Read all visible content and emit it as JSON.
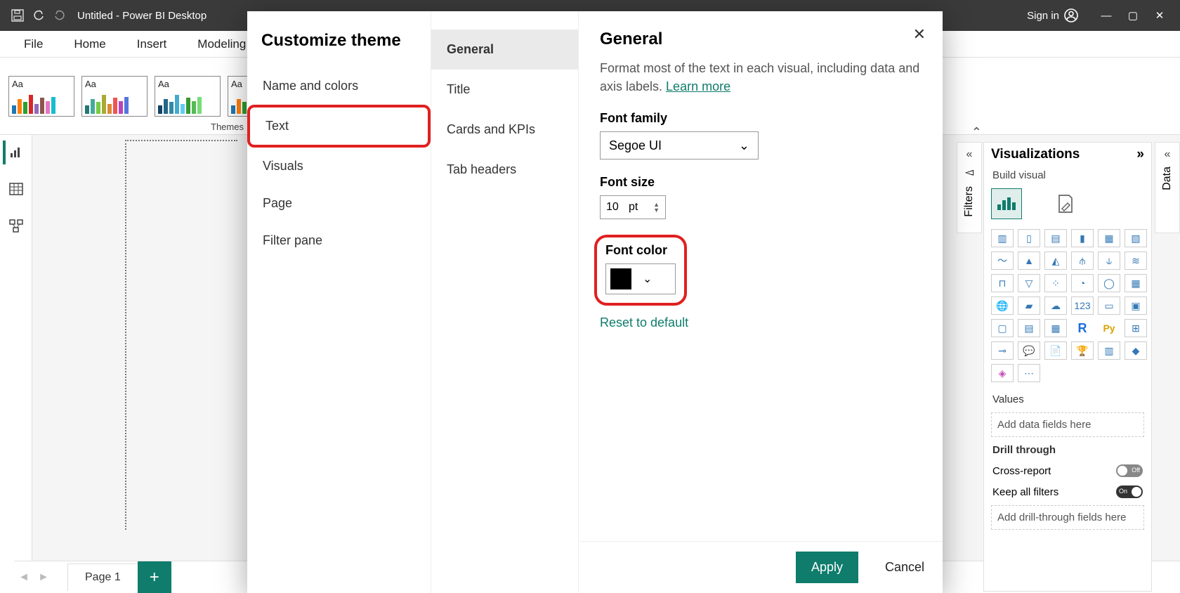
{
  "titlebar": {
    "title": "Untitled - Power BI Desktop",
    "signin": "Sign in"
  },
  "ribbon": {
    "tabs": [
      "File",
      "Home",
      "Insert",
      "Modeling"
    ],
    "group_label": "Themes",
    "aa": "Aa"
  },
  "leftbar": {
    "items": [
      "Report",
      "Data",
      "Model"
    ]
  },
  "pagetabs": {
    "page1": "Page 1"
  },
  "filters_label": "Filters",
  "data_label": "Data",
  "viz": {
    "title": "Visualizations",
    "subtitle": "Build visual",
    "values_label": "Values",
    "values_placeholder": "Add data fields here",
    "drill_label": "Drill through",
    "cross_label": "Cross-report",
    "cross_state": "Off",
    "keep_label": "Keep all filters",
    "keep_state": "On",
    "drill_placeholder": "Add drill-through fields here"
  },
  "dialog": {
    "title": "Customize theme",
    "left_items": [
      "Name and colors",
      "Text",
      "Visuals",
      "Page",
      "Filter pane"
    ],
    "mid_items": [
      "General",
      "Title",
      "Cards and KPIs",
      "Tab headers"
    ],
    "right": {
      "heading": "General",
      "desc_text": "Format most of the text in each visual, including data and axis labels.  ",
      "learn_more": "Learn more",
      "font_family_label": "Font family",
      "font_family_value": "Segoe UI",
      "font_size_label": "Font size",
      "font_size_value": "10",
      "font_size_unit": "pt",
      "font_color_label": "Font color",
      "font_color_value": "#000000",
      "reset": "Reset to default"
    },
    "apply": "Apply",
    "cancel": "Cancel"
  }
}
